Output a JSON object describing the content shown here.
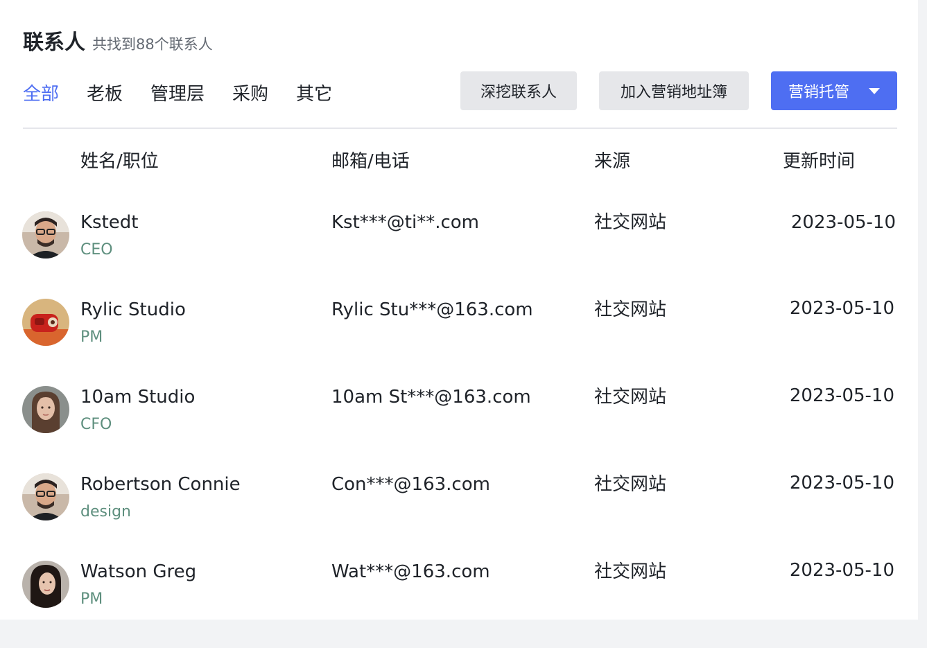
{
  "header": {
    "title": "联系人",
    "subtitle": "共找到88个联系人"
  },
  "tabs": [
    {
      "label": "全部",
      "active": true
    },
    {
      "label": "老板",
      "active": false
    },
    {
      "label": "管理层",
      "active": false
    },
    {
      "label": "采购",
      "active": false
    },
    {
      "label": "其它",
      "active": false
    }
  ],
  "actions": {
    "deep_mine_label": "深挖联系人",
    "add_to_book_label": "加入营销地址簿",
    "marketing_label": "营销托管",
    "dropdown_icon": "caret-down-icon"
  },
  "columns": {
    "name": "姓名/职位",
    "email": "邮箱/电话",
    "source": "来源",
    "updated": "更新时间"
  },
  "colors": {
    "accent": "#4e6ef2",
    "role_text": "#5e8f7e",
    "button_grey": "#e6e7ea"
  },
  "rows": [
    {
      "name": "Kstedt",
      "role": "CEO",
      "email": "Kst***@ti**.com",
      "source": "社交网站",
      "updated": "2023-05-10",
      "avatar": "man-glasses-avatar"
    },
    {
      "name": "Rylic Studio",
      "role": "PM",
      "email": "Rylic Stu***@163.com",
      "source": "社交网站",
      "updated": "2023-05-10",
      "avatar": "studio-object-avatar"
    },
    {
      "name": "10am Studio",
      "role": "CFO",
      "email": "10am St***@163.com",
      "source": "社交网站",
      "updated": "2023-05-10",
      "avatar": "woman-long-hair-avatar"
    },
    {
      "name": "Robertson Connie",
      "role": "design",
      "email": "Con***@163.com",
      "source": "社交网站",
      "updated": "2023-05-10",
      "avatar": "man-glasses-avatar"
    },
    {
      "name": "Watson Greg",
      "role": "PM",
      "email": "Wat***@163.com",
      "source": "社交网站",
      "updated": "2023-05-10",
      "avatar": "woman-dark-hair-avatar"
    }
  ]
}
